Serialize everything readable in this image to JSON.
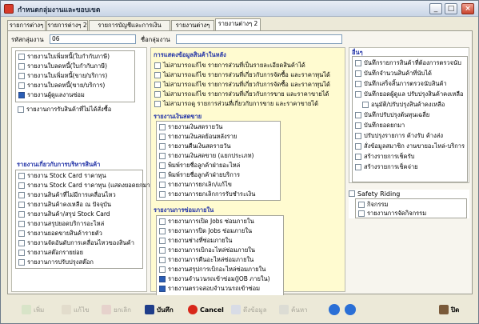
{
  "window": {
    "title": "กำหนดกลุ่มงานและขอบเขต"
  },
  "tabs": [
    {
      "label": "รายการต่างๆ"
    },
    {
      "label": "รายการต่างๆ 2"
    },
    {
      "label": "รายการบัญชีและการเงิน"
    },
    {
      "label": "รายงานต่างๆ"
    },
    {
      "label": "รายงานต่างๆ 2"
    }
  ],
  "header": {
    "group_code_label": "รหัสกลุ่มงาน",
    "group_code_value": "06",
    "group_name_label": "ชื่อกลุ่มงาน",
    "group_name_value": ""
  },
  "left_top_items": [
    {
      "label": "รายงานใบเพิ่มหนี้(ใบกำกับภาษี)",
      "checked": false
    },
    {
      "label": "รายงานใบลดหนี้(ใบกำกับภาษี)",
      "checked": false
    },
    {
      "label": "รายงานใบเพิ่มหนี้(ขาย/บริการ)",
      "checked": false
    },
    {
      "label": "รายงานใบลดหนี้(ขาย/บริการ)",
      "checked": false
    },
    {
      "label": "รายงานผู้ดูแลงานซ่อม",
      "checked": true
    }
  ],
  "left_top_extra": {
    "label": "รายงานการรับสินค้าที่ไม่ได้สั่งซื้อ",
    "checked": false
  },
  "inventory": {
    "title": "รายงานเกี่ยวกับการบริหารสินค้า",
    "items": [
      {
        "label": "รายงาน Stock Card ราคาทุน",
        "checked": false
      },
      {
        "label": "รายงาน Stock Card ราคาทุน (แสดงยอดยกมา)",
        "checked": false
      },
      {
        "label": "รายงานสินค้าที่ไม่มีการเคลื่อนไหว",
        "checked": false
      },
      {
        "label": "รายงานสินค้าคงเหลือ ณ ปัจจุบัน",
        "checked": false
      },
      {
        "label": "รายงานสินค้า/สรุป Stock Card",
        "checked": false
      },
      {
        "label": "รายงานสรุปยอดบริการอะไหล่",
        "checked": false
      },
      {
        "label": "รายงานยอดขายสินค้ารายตัว",
        "checked": false
      },
      {
        "label": "รายงานจัดอันดับการเคลื่อนไหวของสินค้า",
        "checked": false
      },
      {
        "label": "รายงานสต๊อกรายย่อย",
        "checked": false
      },
      {
        "label": "รายงานการปรับปรุงสต๊อก",
        "checked": false
      }
    ]
  },
  "product_info": {
    "title": "การแสดงข้อมูลสินค้าในหลัง",
    "items": [
      {
        "label": "ไม่สามารถแก้ไข รายการส่วนที่เป็นรายละเอียดสินค้าได้",
        "checked": false
      },
      {
        "label": "ไม่สามารถแก้ไข รายการส่วนที่เกี่ยวกับการจัดซื้อ และราคาทุนได้",
        "checked": false
      },
      {
        "label": "ไม่สามารถแก้ไข รายการส่วนที่เกี่ยวกับการจัดซื้อ และราคาทุนได้",
        "checked": false
      },
      {
        "label": "ไม่สามารถแก้ไข รายการส่วนที่เกี่ยวกับการขาย และราคาขายได้",
        "checked": false
      },
      {
        "label": "ไม่สามารถดู รายการส่วนที่เกี่ยวกับการขาย และราคาขายได้",
        "checked": false
      }
    ]
  },
  "cash_reports": {
    "title": "รายงานเงินสดขาย",
    "items": [
      {
        "label": "รายงานเงินสดรายวัน",
        "checked": false
      },
      {
        "label": "รายงานเงินสดย้อนหลังราย",
        "checked": false
      },
      {
        "label": "รายงานคืนเงินสดรายวัน",
        "checked": false
      },
      {
        "label": "รายงานเงินสดขาย (แยกประเภท)",
        "checked": false
      },
      {
        "label": "พิมพ์รายชื่อลูกค้าฝ่ายอะไหล่",
        "checked": false
      },
      {
        "label": "พิมพ์รายชื่อลูกค้าฝ่ายบริการ",
        "checked": false
      },
      {
        "label": "รายงานการยกเลิก/แก้ไข",
        "checked": false
      },
      {
        "label": "รายงานการยกเลิกการรับชำระเงิน",
        "checked": false
      }
    ]
  },
  "repair_reports": {
    "title": "รายงานการซ่อมภายใน",
    "items": [
      {
        "label": "รายงานการเปิด Jobs ซ่อมภายใน",
        "checked": false
      },
      {
        "label": "รายงานการปิด Jobs ซ่อมภายใน",
        "checked": false
      },
      {
        "label": "รายงานช่างที่ซ่อมภายใน",
        "checked": false
      },
      {
        "label": "รายงานการเบิกอะไหล่ซ่อมภายใน",
        "checked": false
      },
      {
        "label": "รายงานการคืนอะไหล่ซ่อมภายใน",
        "checked": false
      },
      {
        "label": "รายงานสรุปการเบิกอะไหล่ซ่อมภายใน",
        "checked": false
      },
      {
        "label": "รายงานจำนวนรถเข้าซ่อม(JOB ภายใน)",
        "checked": true
      },
      {
        "label": "รายงานตรวจสอบจำนวนรถเข้าซ่อม",
        "checked": true
      }
    ]
  },
  "others": {
    "title": "อื่นๆ",
    "items": [
      {
        "label": "บันทึกรายการสินค้าที่ต้องการตรวจนับ",
        "checked": false
      },
      {
        "label": "บันทึกจำนวนสินค้าที่นับได้",
        "checked": false
      },
      {
        "label": "บันทึกเสร็จสิ้นการตรวจนับสินค้า",
        "checked": false
      },
      {
        "label": "บันทึกยอดผู้ดูแล ปรับปรุงสินค้าคงเหลือ",
        "checked": false
      },
      {
        "label": "อนุมัติ/ปรับปรุงสินค้าคงเหลือ",
        "checked": false
      },
      {
        "label": "บันทึกปรับปรุงต้นทุนเฉลี่ย",
        "checked": false
      },
      {
        "label": "บันทึกยอดยกมา",
        "checked": false
      },
      {
        "label": "ปรับปรุงรายการ ค้างรับ ค้างส่ง",
        "checked": false
      },
      {
        "label": "สั่งข้อมูลสมาชิก งานขายอะไหล่-บริการ",
        "checked": false
      },
      {
        "label": "สร้างรายการเช็ครับ",
        "checked": false
      },
      {
        "label": "สร้างรายการเช็คจ่าย",
        "checked": false
      }
    ]
  },
  "safety": {
    "title": "Safety Riding",
    "items": [
      {
        "label": "กิจกรรม",
        "checked": false
      },
      {
        "label": "รายงานการจัดกิจกรรม",
        "checked": false
      }
    ]
  },
  "toolbar": {
    "add": "เพิ่ม",
    "edit": "แก้ไข",
    "cancel_item": "ยกเลิก",
    "save": "บันทึก",
    "cancel": "Cancel",
    "pull": "ดึงข้อมูล",
    "search": "ค้นหา",
    "close": "ปิด"
  },
  "colors": {
    "section_title": "#2435a8",
    "yellow_panel": "#fffbd0",
    "checked_box": "#2a5db5"
  }
}
